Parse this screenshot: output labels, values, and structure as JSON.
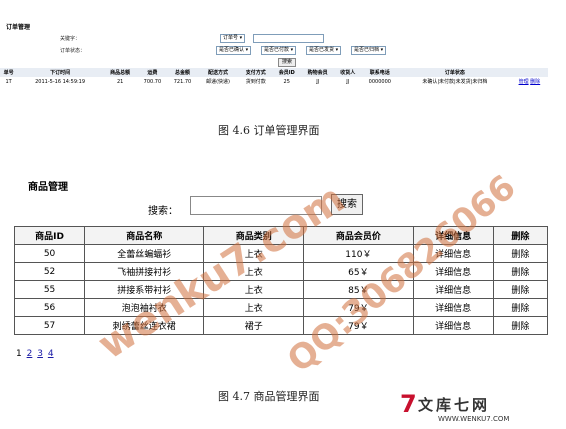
{
  "order_mgmt": {
    "title": "订单管理",
    "keyword_label": "关键字：",
    "keyword_select": "订单号",
    "status_label": "订单状态：",
    "status_options": [
      "是否已确认",
      "是否已付款",
      "是否已发货",
      "是否已归档"
    ],
    "search_btn": "搜索",
    "columns": [
      "单号",
      "下订时间",
      "商品总额",
      "运费",
      "总金额",
      "配送方式",
      "支付方式",
      "会员ID",
      "购物会员",
      "收货人",
      "联系电话",
      "订单状态",
      ""
    ],
    "row": {
      "id": "1T",
      "time": "2011-5-16 14:59:19",
      "goods_total": "21",
      "shipping": "700.70",
      "total": "721.70",
      "delivery": "邮递(快递)",
      "payment": "货到付款",
      "member_id": "25",
      "member": "JJ",
      "receiver": "JJ",
      "phone": "0000000",
      "status": "未确认|未付款|未发货|未归档",
      "manage": "管理",
      "delete": "删除"
    }
  },
  "caption1": "图 4.6  订单管理界面",
  "goods_mgmt": {
    "title": "商品管理",
    "search_label": "搜索：",
    "search_btn": "搜索",
    "columns": [
      "商品ID",
      "商品名称",
      "商品类别",
      "商品会员价",
      "详细信息",
      "删除"
    ],
    "rows": [
      {
        "id": "50",
        "name": "全蕾丝蝙蝠衫",
        "cat": "上衣",
        "price": "110￥",
        "detail": "详细信息",
        "del": "删除"
      },
      {
        "id": "52",
        "name": "飞袖拼接衬衫",
        "cat": "上衣",
        "price": "65￥",
        "detail": "详细信息",
        "del": "删除"
      },
      {
        "id": "55",
        "name": "拼接系带衬衫",
        "cat": "上衣",
        "price": "85￥",
        "detail": "详细信息",
        "del": "删除"
      },
      {
        "id": "56",
        "name": "泡泡袖衬衣",
        "cat": "上衣",
        "price": "79￥",
        "detail": "详细信息",
        "del": "删除"
      },
      {
        "id": "57",
        "name": "刺绣蕾丝连衣裙",
        "cat": "裙子",
        "price": "79￥",
        "detail": "详细信息",
        "del": "删除"
      }
    ],
    "pager": [
      "1",
      "2",
      "3",
      "4"
    ]
  },
  "caption2": "图 4.7  商品管理界面",
  "watermark": {
    "text1": "wenku7.com",
    "text2": "QQ:306826066"
  },
  "logo": {
    "mark": "7",
    "text": "文库七网",
    "url": "WWW.WENKU7.COM"
  },
  "colors": {
    "watermark": "#d0703c",
    "link": "#0000cc",
    "logo_red": "#c8102e"
  }
}
